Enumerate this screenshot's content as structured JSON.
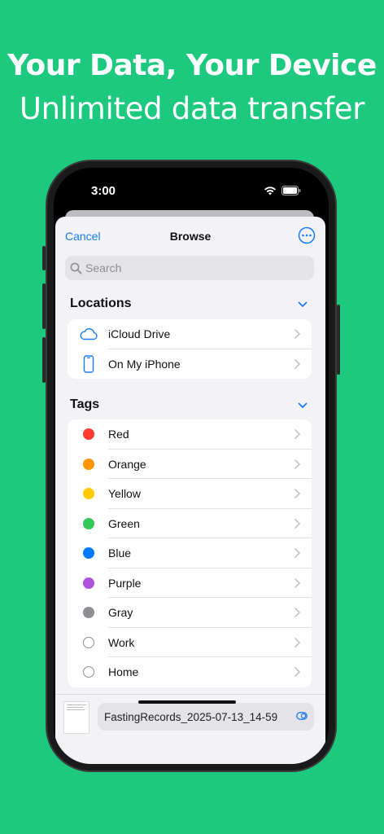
{
  "promo": {
    "headline": "Your Data, Your Device",
    "subline": "Unlimited data transfer"
  },
  "status_bar": {
    "time": "3:00"
  },
  "nav": {
    "cancel": "Cancel",
    "title": "Browse"
  },
  "search": {
    "placeholder": "Search"
  },
  "locations": {
    "header": "Locations",
    "items": [
      {
        "label": "iCloud Drive",
        "icon": "cloud-icon"
      },
      {
        "label": "On My iPhone",
        "icon": "iphone-icon"
      }
    ]
  },
  "tags": {
    "header": "Tags",
    "items": [
      {
        "label": "Red",
        "color": "#ff3b30"
      },
      {
        "label": "Orange",
        "color": "#ff9500"
      },
      {
        "label": "Yellow",
        "color": "#ffcc00"
      },
      {
        "label": "Green",
        "color": "#34c759"
      },
      {
        "label": "Blue",
        "color": "#007aff"
      },
      {
        "label": "Purple",
        "color": "#af52de"
      },
      {
        "label": "Gray",
        "color": "#8e8e93"
      },
      {
        "label": "Work",
        "color": ""
      },
      {
        "label": "Home",
        "color": ""
      }
    ]
  },
  "file": {
    "name": "FastingRecords_2025-07-13_14-59"
  },
  "colors": {
    "accent": "#1a7cf5",
    "background": "#1cc97e"
  }
}
